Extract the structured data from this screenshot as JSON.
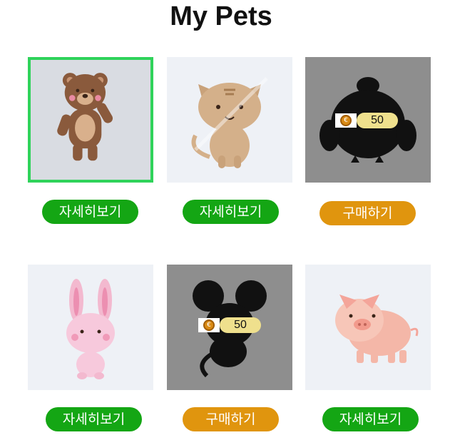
{
  "title": "My Pets",
  "colors": {
    "detail_button": "#14a614",
    "buy_button": "#e0950e",
    "selected_border": "#2fd35a",
    "locked_background": "#8e8e8e",
    "price_pill": "#efe08d"
  },
  "pets": [
    {
      "name": "bear",
      "image": "bear-image",
      "state": "owned",
      "selected": true,
      "button_label": "자세히보기"
    },
    {
      "name": "cat",
      "image": "cat-image",
      "state": "owned",
      "selected": false,
      "button_label": "자세히보기"
    },
    {
      "name": "bird",
      "image": "bird-silhouette-image",
      "state": "locked",
      "price": "50",
      "coin_icon": "coin-icon",
      "button_label": "구매하기"
    },
    {
      "name": "rabbit",
      "image": "rabbit-image",
      "state": "owned",
      "selected": false,
      "button_label": "자세히보기"
    },
    {
      "name": "mouse",
      "image": "mouse-silhouette-image",
      "state": "locked",
      "price": "50",
      "coin_icon": "coin-icon",
      "button_label": "구매하기"
    },
    {
      "name": "pig",
      "image": "pig-image",
      "state": "owned",
      "selected": false,
      "button_label": "자세히보기"
    }
  ]
}
